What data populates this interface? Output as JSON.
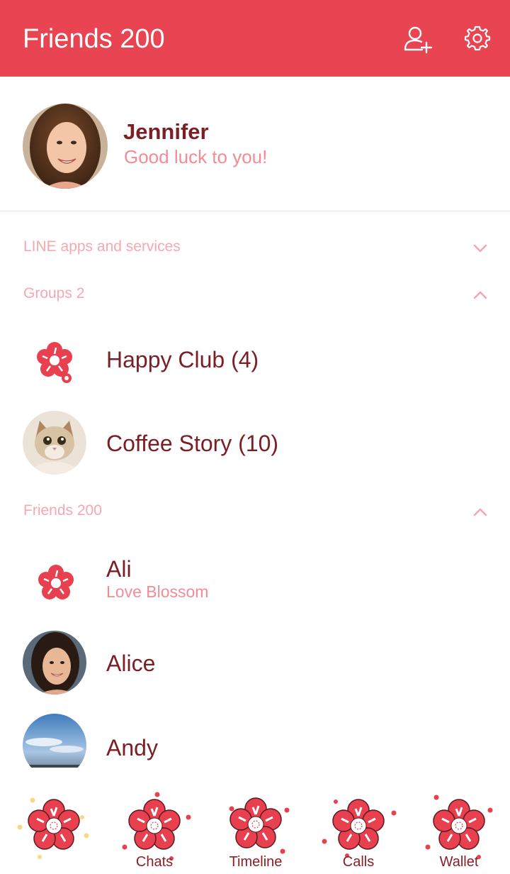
{
  "header": {
    "title": "Friends 200"
  },
  "profile": {
    "name": "Jennifer",
    "status": "Good luck to you!"
  },
  "sections": {
    "line_apps": "LINE apps and services",
    "groups": "Groups 2",
    "friends": "Friends 200"
  },
  "groups": [
    {
      "name": "Happy Club (4)",
      "avatar": "blossom-icon"
    },
    {
      "name": "Coffee Story (10)",
      "avatar": "cat-photo"
    }
  ],
  "friends": [
    {
      "name": "Ali",
      "status": "Love Blossom",
      "avatar": "blossom-icon"
    },
    {
      "name": "Alice",
      "avatar": "woman-photo"
    },
    {
      "name": "Andy",
      "avatar": "sky-photo"
    }
  ],
  "tabs": [
    {
      "id": "friends",
      "label": "",
      "icon": "blossom-icon"
    },
    {
      "id": "chats",
      "label": "Chats",
      "icon": "blossom-icon"
    },
    {
      "id": "timeline",
      "label": "Timeline",
      "icon": "blossom-icon"
    },
    {
      "id": "calls",
      "label": "Calls",
      "icon": "blossom-icon"
    },
    {
      "id": "wallet",
      "label": "Wallet",
      "icon": "blossom-icon"
    }
  ],
  "colors": {
    "header_bg": "#e94452",
    "name_text": "#7a1f25",
    "status_text": "#f18c97",
    "section_text": "#f6a8b0",
    "blossom": "#e8404f"
  }
}
